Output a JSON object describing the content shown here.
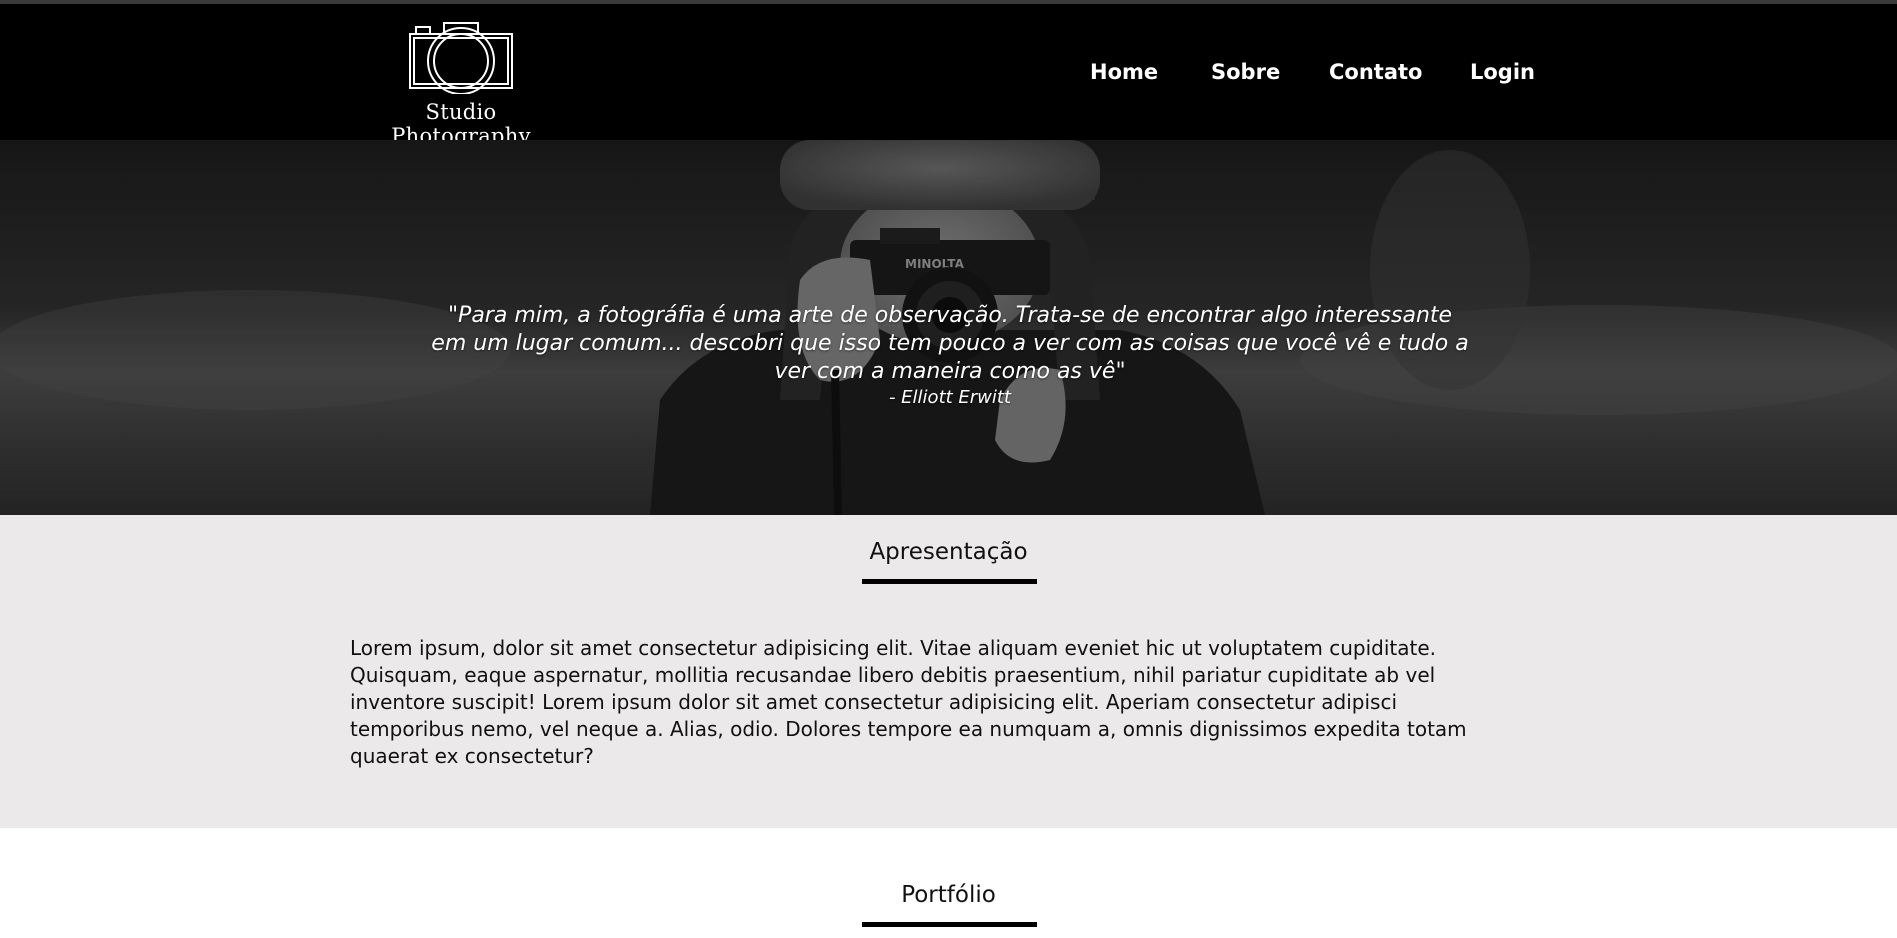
{
  "header": {
    "logo_text": "Studio Photography",
    "nav": [
      {
        "label": "Home"
      },
      {
        "label": "Sobre"
      },
      {
        "label": "Contato"
      },
      {
        "label": "Login"
      }
    ]
  },
  "hero": {
    "camera_brand": "MINOLTA",
    "quote_line1": "\"Para mim, a fotográfia é uma arte de observação. Trata-se de encontrar algo interessante",
    "quote_line2": "em um lugar comum... descobri que isso tem pouco a ver com as coisas que você vê e tudo a",
    "quote_line3": "ver com a maneira como as vê\"",
    "author": "- Elliott Erwitt"
  },
  "about": {
    "title": "Apresentação",
    "lines": [
      "Lorem ipsum, dolor sit amet consectetur adipisicing elit. Vitae aliquam eveniet hic ut voluptatem cupiditate.",
      "Quisquam, eaque aspernatur, mollitia recusandae libero debitis praesentium, nihil pariatur cupiditate ab vel",
      "inventore suscipit! Lorem ipsum dolor sit amet consectetur adipisicing elit. Aperiam consectetur adipisci",
      "temporibus nemo, vel neque a. Alias, odio. Dolores tempore ea numquam a, omnis dignissimos expedita totam",
      "quaerat ex consectetur?"
    ]
  },
  "portfolio": {
    "title": "Portfólio"
  },
  "colors": {
    "header_bg": "#000000",
    "about_bg": "#ebe9e9",
    "accent_bar": "#000000",
    "nav_text": "#ffffff"
  }
}
